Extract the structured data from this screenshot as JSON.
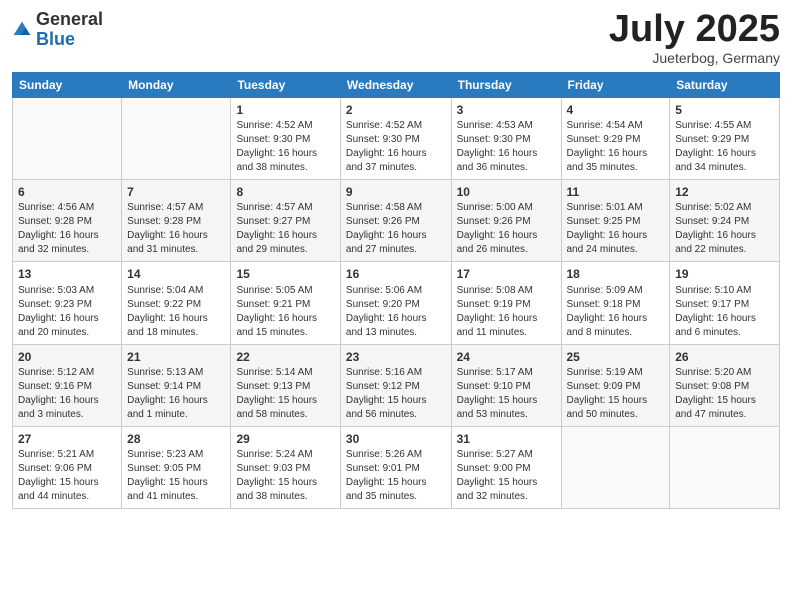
{
  "header": {
    "logo_general": "General",
    "logo_blue": "Blue",
    "title": "July 2025",
    "subtitle": "Jueterbog, Germany"
  },
  "weekdays": [
    "Sunday",
    "Monday",
    "Tuesday",
    "Wednesday",
    "Thursday",
    "Friday",
    "Saturday"
  ],
  "weeks": [
    [
      {
        "day": "",
        "info": ""
      },
      {
        "day": "",
        "info": ""
      },
      {
        "day": "1",
        "info": "Sunrise: 4:52 AM\nSunset: 9:30 PM\nDaylight: 16 hours and 38 minutes."
      },
      {
        "day": "2",
        "info": "Sunrise: 4:52 AM\nSunset: 9:30 PM\nDaylight: 16 hours and 37 minutes."
      },
      {
        "day": "3",
        "info": "Sunrise: 4:53 AM\nSunset: 9:30 PM\nDaylight: 16 hours and 36 minutes."
      },
      {
        "day": "4",
        "info": "Sunrise: 4:54 AM\nSunset: 9:29 PM\nDaylight: 16 hours and 35 minutes."
      },
      {
        "day": "5",
        "info": "Sunrise: 4:55 AM\nSunset: 9:29 PM\nDaylight: 16 hours and 34 minutes."
      }
    ],
    [
      {
        "day": "6",
        "info": "Sunrise: 4:56 AM\nSunset: 9:28 PM\nDaylight: 16 hours and 32 minutes."
      },
      {
        "day": "7",
        "info": "Sunrise: 4:57 AM\nSunset: 9:28 PM\nDaylight: 16 hours and 31 minutes."
      },
      {
        "day": "8",
        "info": "Sunrise: 4:57 AM\nSunset: 9:27 PM\nDaylight: 16 hours and 29 minutes."
      },
      {
        "day": "9",
        "info": "Sunrise: 4:58 AM\nSunset: 9:26 PM\nDaylight: 16 hours and 27 minutes."
      },
      {
        "day": "10",
        "info": "Sunrise: 5:00 AM\nSunset: 9:26 PM\nDaylight: 16 hours and 26 minutes."
      },
      {
        "day": "11",
        "info": "Sunrise: 5:01 AM\nSunset: 9:25 PM\nDaylight: 16 hours and 24 minutes."
      },
      {
        "day": "12",
        "info": "Sunrise: 5:02 AM\nSunset: 9:24 PM\nDaylight: 16 hours and 22 minutes."
      }
    ],
    [
      {
        "day": "13",
        "info": "Sunrise: 5:03 AM\nSunset: 9:23 PM\nDaylight: 16 hours and 20 minutes."
      },
      {
        "day": "14",
        "info": "Sunrise: 5:04 AM\nSunset: 9:22 PM\nDaylight: 16 hours and 18 minutes."
      },
      {
        "day": "15",
        "info": "Sunrise: 5:05 AM\nSunset: 9:21 PM\nDaylight: 16 hours and 15 minutes."
      },
      {
        "day": "16",
        "info": "Sunrise: 5:06 AM\nSunset: 9:20 PM\nDaylight: 16 hours and 13 minutes."
      },
      {
        "day": "17",
        "info": "Sunrise: 5:08 AM\nSunset: 9:19 PM\nDaylight: 16 hours and 11 minutes."
      },
      {
        "day": "18",
        "info": "Sunrise: 5:09 AM\nSunset: 9:18 PM\nDaylight: 16 hours and 8 minutes."
      },
      {
        "day": "19",
        "info": "Sunrise: 5:10 AM\nSunset: 9:17 PM\nDaylight: 16 hours and 6 minutes."
      }
    ],
    [
      {
        "day": "20",
        "info": "Sunrise: 5:12 AM\nSunset: 9:16 PM\nDaylight: 16 hours and 3 minutes."
      },
      {
        "day": "21",
        "info": "Sunrise: 5:13 AM\nSunset: 9:14 PM\nDaylight: 16 hours and 1 minute."
      },
      {
        "day": "22",
        "info": "Sunrise: 5:14 AM\nSunset: 9:13 PM\nDaylight: 15 hours and 58 minutes."
      },
      {
        "day": "23",
        "info": "Sunrise: 5:16 AM\nSunset: 9:12 PM\nDaylight: 15 hours and 56 minutes."
      },
      {
        "day": "24",
        "info": "Sunrise: 5:17 AM\nSunset: 9:10 PM\nDaylight: 15 hours and 53 minutes."
      },
      {
        "day": "25",
        "info": "Sunrise: 5:19 AM\nSunset: 9:09 PM\nDaylight: 15 hours and 50 minutes."
      },
      {
        "day": "26",
        "info": "Sunrise: 5:20 AM\nSunset: 9:08 PM\nDaylight: 15 hours and 47 minutes."
      }
    ],
    [
      {
        "day": "27",
        "info": "Sunrise: 5:21 AM\nSunset: 9:06 PM\nDaylight: 15 hours and 44 minutes."
      },
      {
        "day": "28",
        "info": "Sunrise: 5:23 AM\nSunset: 9:05 PM\nDaylight: 15 hours and 41 minutes."
      },
      {
        "day": "29",
        "info": "Sunrise: 5:24 AM\nSunset: 9:03 PM\nDaylight: 15 hours and 38 minutes."
      },
      {
        "day": "30",
        "info": "Sunrise: 5:26 AM\nSunset: 9:01 PM\nDaylight: 15 hours and 35 minutes."
      },
      {
        "day": "31",
        "info": "Sunrise: 5:27 AM\nSunset: 9:00 PM\nDaylight: 15 hours and 32 minutes."
      },
      {
        "day": "",
        "info": ""
      },
      {
        "day": "",
        "info": ""
      }
    ]
  ]
}
